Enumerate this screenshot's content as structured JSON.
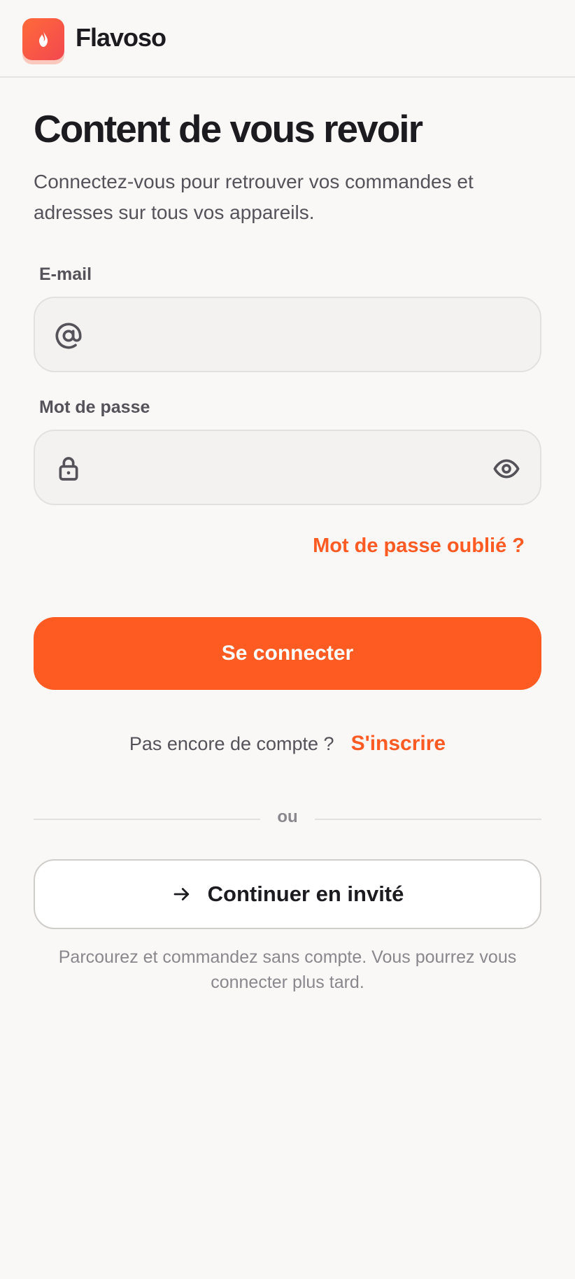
{
  "app": {
    "name": "Flavoso",
    "logo_icon": "flame-icon"
  },
  "page": {
    "title": "Content de vous revoir",
    "subtitle": "Connectez-vous pour retrouver vos commandes et adresses sur tous vos appareils."
  },
  "email": {
    "label": "E-mail",
    "value": "",
    "placeholder": "",
    "icon": "at-sign-icon"
  },
  "password": {
    "label": "Mot de passe",
    "value": "",
    "placeholder": "",
    "icon": "lock-icon",
    "toggle_icon": "eye-icon"
  },
  "forgot_password": "Mot de passe oublié ?",
  "login_button": "Se connecter",
  "signup": {
    "prompt": "Pas encore de compte ?",
    "link": "S'inscrire"
  },
  "divider": "ou",
  "guest": {
    "button": "Continuer en invité",
    "icon": "arrow-right-icon",
    "note": "Parcourez et commandez sans compte. Vous pourrez vous connecter plus tard."
  },
  "colors": {
    "accent": "#fe5b22",
    "background": "#f9f8f6",
    "text": "#1c1b1f",
    "muted": "#55535a"
  }
}
